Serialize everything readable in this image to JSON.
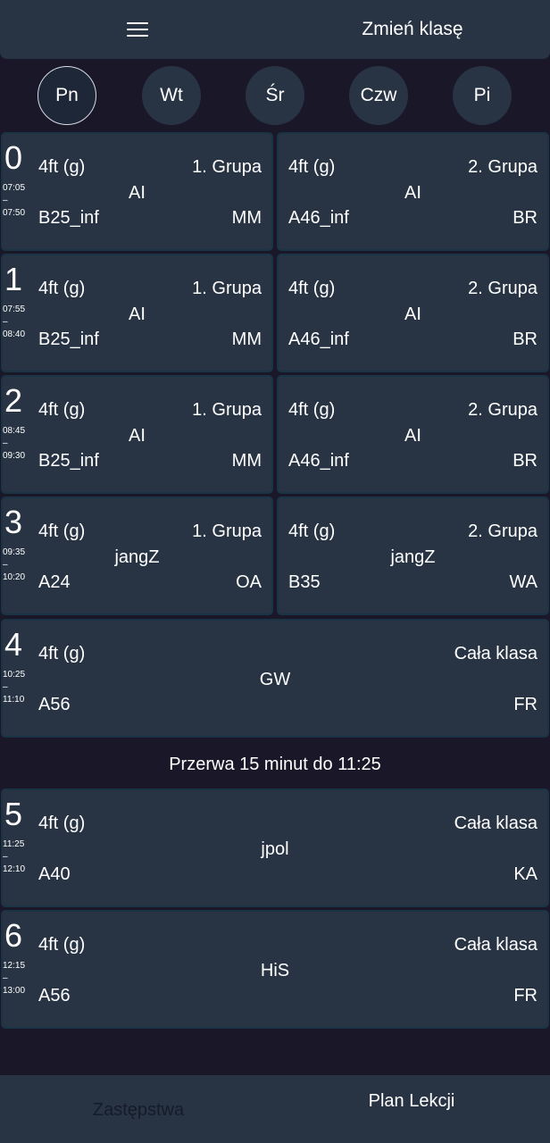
{
  "header": {
    "change_class_label": "Zmień klasę"
  },
  "days": [
    "Pn",
    "Wt",
    "Śr",
    "Czw",
    "Pi"
  ],
  "lessons": [
    {
      "num": "0",
      "start": "07:05",
      "sep": "–",
      "end": "07:50",
      "groups": [
        {
          "class": "4ft (g)",
          "group": "1. Grupa",
          "subject": "AI",
          "room": "B25_inf",
          "teacher": "MM"
        },
        {
          "class": "4ft (g)",
          "group": "2. Grupa",
          "subject": "AI",
          "room": "A46_inf",
          "teacher": "BR"
        }
      ]
    },
    {
      "num": "1",
      "start": "07:55",
      "sep": "–",
      "end": "08:40",
      "groups": [
        {
          "class": "4ft (g)",
          "group": "1. Grupa",
          "subject": "AI",
          "room": "B25_inf",
          "teacher": "MM"
        },
        {
          "class": "4ft (g)",
          "group": "2. Grupa",
          "subject": "AI",
          "room": "A46_inf",
          "teacher": "BR"
        }
      ]
    },
    {
      "num": "2",
      "start": "08:45",
      "sep": "–",
      "end": "09:30",
      "groups": [
        {
          "class": "4ft (g)",
          "group": "1. Grupa",
          "subject": "AI",
          "room": "B25_inf",
          "teacher": "MM"
        },
        {
          "class": "4ft (g)",
          "group": "2. Grupa",
          "subject": "AI",
          "room": "A46_inf",
          "teacher": "BR"
        }
      ]
    },
    {
      "num": "3",
      "start": "09:35",
      "sep": "–",
      "end": "10:20",
      "groups": [
        {
          "class": "4ft (g)",
          "group": "1. Grupa",
          "subject": "jangZ",
          "room": "A24",
          "teacher": "OA"
        },
        {
          "class": "4ft (g)",
          "group": "2. Grupa",
          "subject": "jangZ",
          "room": "B35",
          "teacher": "WA"
        }
      ]
    },
    {
      "num": "4",
      "start": "10:25",
      "sep": "–",
      "end": "11:10",
      "groups": [
        {
          "class": "4ft (g)",
          "group": "Cała klasa",
          "subject": "GW",
          "room": "A56",
          "teacher": "FR"
        }
      ]
    },
    {
      "num": "5",
      "start": "11:25",
      "sep": "–",
      "end": "12:10",
      "groups": [
        {
          "class": "4ft (g)",
          "group": "Cała klasa",
          "subject": "jpol",
          "room": "A40",
          "teacher": "KA"
        }
      ]
    },
    {
      "num": "6",
      "start": "12:15",
      "sep": "–",
      "end": "13:00",
      "groups": [
        {
          "class": "4ft (g)",
          "group": "Cała klasa",
          "subject": "HiS",
          "room": "A56",
          "teacher": "FR"
        }
      ]
    }
  ],
  "break_text": "Przerwa 15 minut do 11:25",
  "bottom_tabs": {
    "substitutions": "Zastępstwa",
    "plan": "Plan Lekcji"
  },
  "colors": {
    "background": "#1a1729",
    "surface": "#283444",
    "card_border": "#1b3445",
    "text": "#ffffff"
  }
}
